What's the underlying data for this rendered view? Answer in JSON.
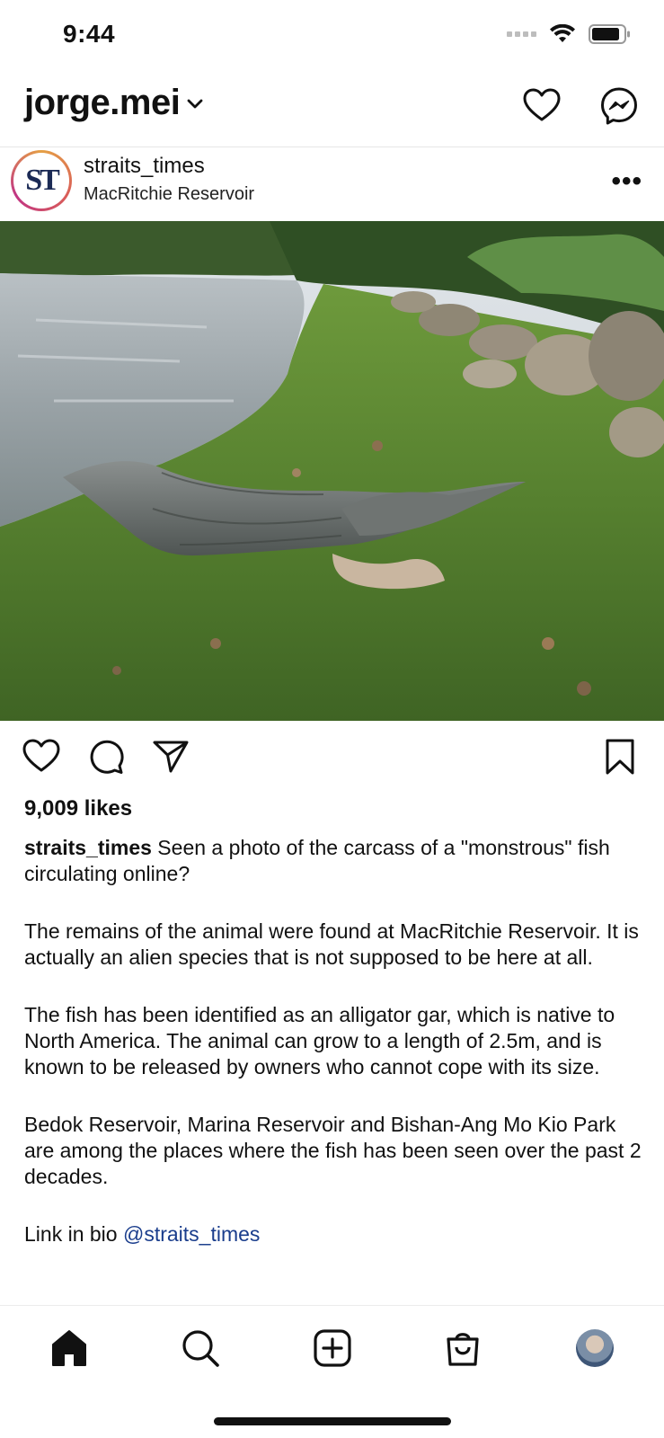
{
  "status": {
    "time": "9:44"
  },
  "header": {
    "account_name": "jorge.mei"
  },
  "post": {
    "username": "straits_times",
    "location": "MacRitchie Reservoir",
    "avatar_text": "ST",
    "likes": "9,009 likes",
    "caption": {
      "username": "straits_times",
      "p1": " Seen a photo of the carcass of a \"monstrous\" fish circulating online?",
      "p2": "The remains of the animal were found at MacRitchie Reservoir. It is actually an alien species that is not supposed to be here at all.",
      "p3": "The fish has been identified as an alligator gar, which is native to North America. The animal can grow to a length of 2.5m, and is known to be released by owners who cannot cope with its size.",
      "p4": "Bedok Reservoir, Marina Reservoir and Bishan-Ang Mo Kio Park are among the places where the fish has been seen over the past 2 decades.",
      "link_prefix": "Link in bio ",
      "mention": "@straits_times"
    }
  },
  "icons": {
    "header": [
      "heart-icon",
      "messenger-icon"
    ],
    "actions": [
      "heart-icon",
      "comment-icon",
      "share-icon",
      "bookmark-icon"
    ],
    "nav": [
      "home-icon",
      "search-icon",
      "create-icon",
      "shop-icon",
      "profile-avatar"
    ]
  },
  "colors": {
    "mention": "#1a3d8c",
    "text": "#111111",
    "avatar_ring": "#d95d58"
  }
}
